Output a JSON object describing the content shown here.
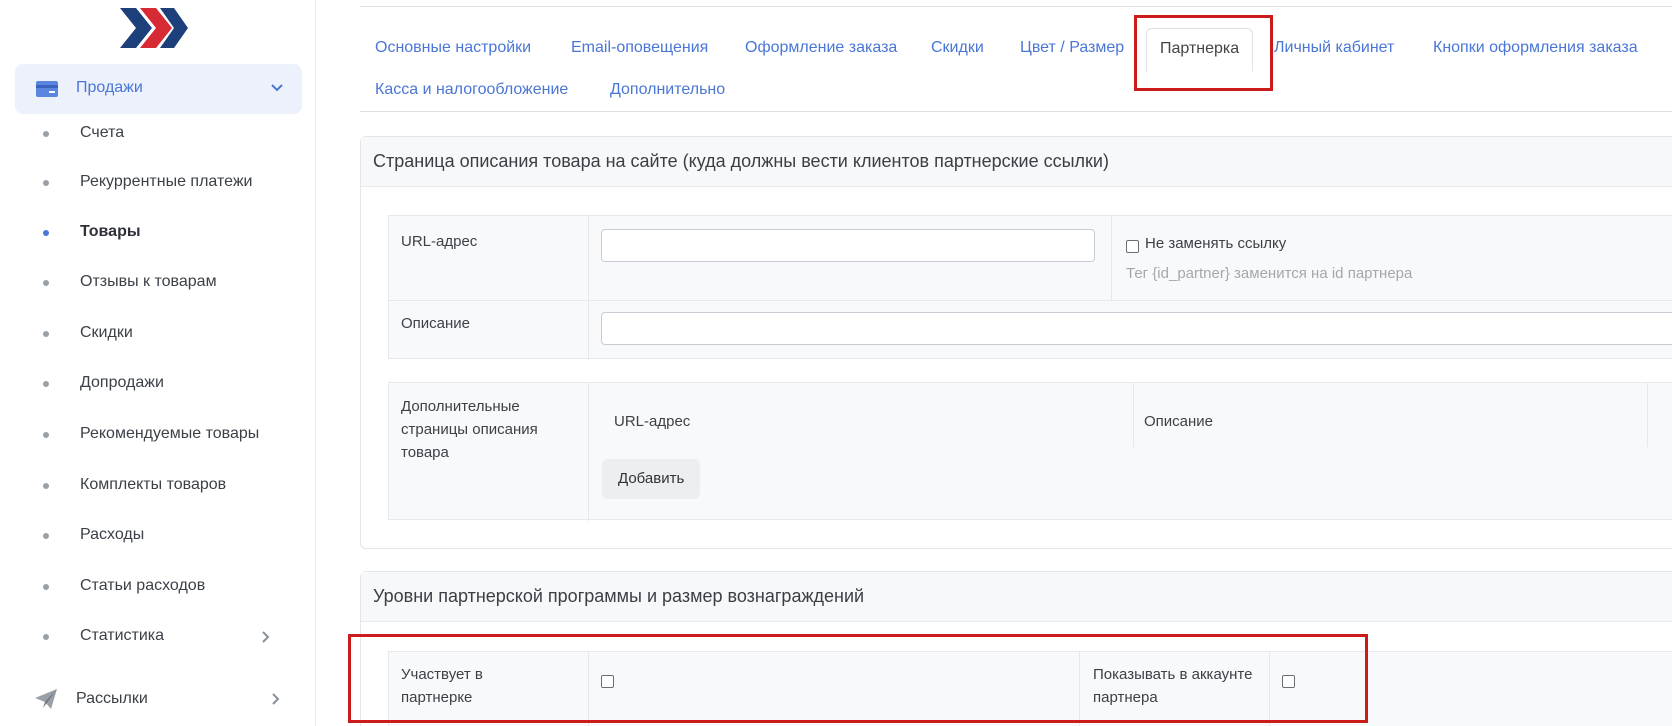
{
  "sidebar": {
    "sales": {
      "label": "Продажи"
    },
    "items": [
      {
        "label": "Счета"
      },
      {
        "label": "Рекуррентные платежи"
      },
      {
        "label": "Товары"
      },
      {
        "label": "Отзывы к товарам"
      },
      {
        "label": "Скидки"
      },
      {
        "label": "Допродажи"
      },
      {
        "label": "Рекомендуемые товары"
      },
      {
        "label": "Комплекты товаров"
      },
      {
        "label": "Расходы"
      },
      {
        "label": "Статьи расходов"
      },
      {
        "label": "Статистика"
      }
    ],
    "mailings": {
      "label": "Рассылки"
    },
    "colors": {
      "accent": "#4a76d6",
      "active_bg": "#edf1fb"
    }
  },
  "tabs": [
    {
      "label": "Основные настройки"
    },
    {
      "label": "Email-оповещения"
    },
    {
      "label": "Оформление заказа"
    },
    {
      "label": "Скидки"
    },
    {
      "label": "Цвет / Размер"
    },
    {
      "label": "Партнерка"
    },
    {
      "label": "Личный кабинет"
    },
    {
      "label": "Кнопки оформления заказа"
    },
    {
      "label": "Касса и налогообложение"
    },
    {
      "label": "Дополнительно"
    }
  ],
  "product_page": {
    "title": "Страница описания товара на сайте (куда должны вести клиентов партнерские ссылки)",
    "url_label": "URL-адрес",
    "url_value": "",
    "no_replace_label": "Не заменять ссылку",
    "hint": "Тег {id_partner} заменится на id партнера",
    "description_label": "Описание",
    "description_value": "",
    "extra_pages_label": "Дополнительные страницы описания товара",
    "extra_url_header": "URL-адрес",
    "extra_desc_header": "Описание",
    "add_button": "Добавить"
  },
  "levels": {
    "title": "Уровни партнерской программы и размер вознаграждений",
    "participates_label": "Участвует в партнерке",
    "show_in_account_label": "Показывать в аккаунте партнера"
  },
  "highlight_color": "#cc1b1b"
}
